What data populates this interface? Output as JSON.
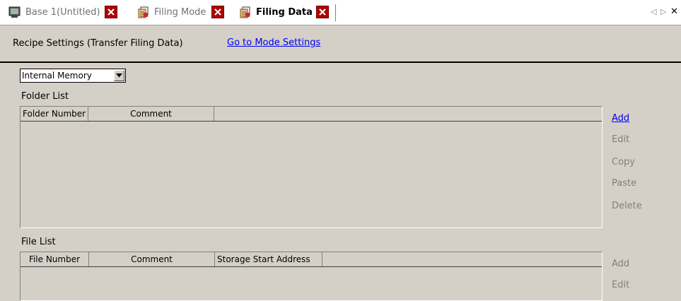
{
  "tabs": [
    {
      "label": "Base 1(Untitled)",
      "icon": "monitor-icon",
      "active": false
    },
    {
      "label": "Filing Mode",
      "icon": "filing-icon",
      "active": false
    },
    {
      "label": "Filing Data",
      "icon": "filing-icon",
      "active": true
    }
  ],
  "tab_nav": {
    "prev": "◁",
    "next": "▷",
    "close": "✕"
  },
  "header": {
    "title": "Recipe Settings (Transfer Filing Data)",
    "link": "Go to Mode Settings"
  },
  "memory_select": {
    "value": "Internal Memory"
  },
  "folder_list": {
    "label": "Folder List",
    "columns": [
      "Folder Number",
      "Comment",
      ""
    ]
  },
  "folder_actions": [
    {
      "label": "Add",
      "enabled": true
    },
    {
      "label": "Edit",
      "enabled": false
    },
    {
      "label": "Copy",
      "enabled": false
    },
    {
      "label": "Paste",
      "enabled": false
    },
    {
      "label": "Delete",
      "enabled": false
    }
  ],
  "file_list": {
    "label": "File List",
    "columns": [
      "File Number",
      "Comment",
      "Storage Start Address",
      ""
    ]
  },
  "file_actions": [
    {
      "label": "Add",
      "enabled": false
    },
    {
      "label": "Edit",
      "enabled": false
    }
  ],
  "colors": {
    "link": "#0000ee",
    "close_button": "#b10000",
    "disabled_text": "#808080"
  }
}
